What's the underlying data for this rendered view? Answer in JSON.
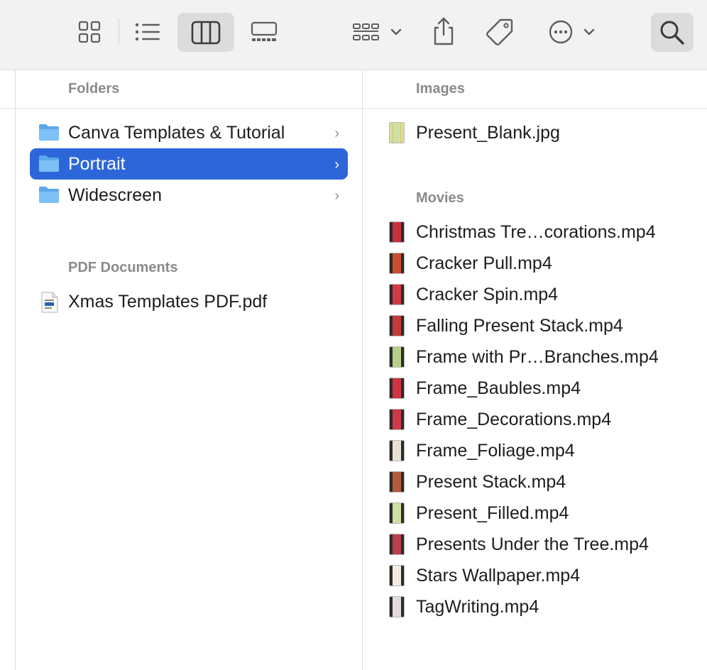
{
  "toolbar": {
    "view_icons": [
      "icon-view-icon",
      "list-view-icon",
      "column-view-icon",
      "gallery-view-icon"
    ],
    "active_view": "column-view",
    "actions": [
      "group-icon",
      "share-icon",
      "tag-icon",
      "more-icon",
      "search-icon"
    ]
  },
  "folders_column": {
    "header": "Folders",
    "items": [
      {
        "label": "Canva Templates & Tutorial",
        "selected": false
      },
      {
        "label": "Portrait",
        "selected": true
      },
      {
        "label": "Widescreen",
        "selected": false
      }
    ],
    "pdf_header": "PDF Documents",
    "pdf_items": [
      {
        "label": "Xmas Templates PDF.pdf"
      }
    ]
  },
  "preview_column": {
    "images_header": "Images",
    "images": [
      {
        "label": "Present_Blank.jpg",
        "color": "#cfe0a6"
      }
    ],
    "movies_header": "Movies",
    "movies": [
      {
        "label": "Christmas Tre…corations.mp4",
        "color": "#c8323c"
      },
      {
        "label": "Cracker Pull.mp4",
        "color": "#c85030"
      },
      {
        "label": "Cracker Spin.mp4",
        "color": "#d23a46"
      },
      {
        "label": "Falling Present Stack.mp4",
        "color": "#c43a3a"
      },
      {
        "label": "Frame with Pr…Branches.mp4",
        "color": "#b6d08a"
      },
      {
        "label": "Frame_Baubles.mp4",
        "color": "#cf3340"
      },
      {
        "label": "Frame_Decorations.mp4",
        "color": "#d03a48"
      },
      {
        "label": "Frame_Foliage.mp4",
        "color": "#e8e2d4"
      },
      {
        "label": "Present Stack.mp4",
        "color": "#b45a3c"
      },
      {
        "label": "Present_Filled.mp4",
        "color": "#cfe0a0"
      },
      {
        "label": "Presents Under the Tree.mp4",
        "color": "#b8404a"
      },
      {
        "label": "Stars Wallpaper.mp4",
        "color": "#f2ece0"
      },
      {
        "label": "TagWriting.mp4",
        "color": "#e4dcdc"
      }
    ]
  },
  "colors": {
    "selection": "#2d66d9",
    "folder_blue": "#6fb7f2",
    "header_gray": "#8a8a8e"
  }
}
